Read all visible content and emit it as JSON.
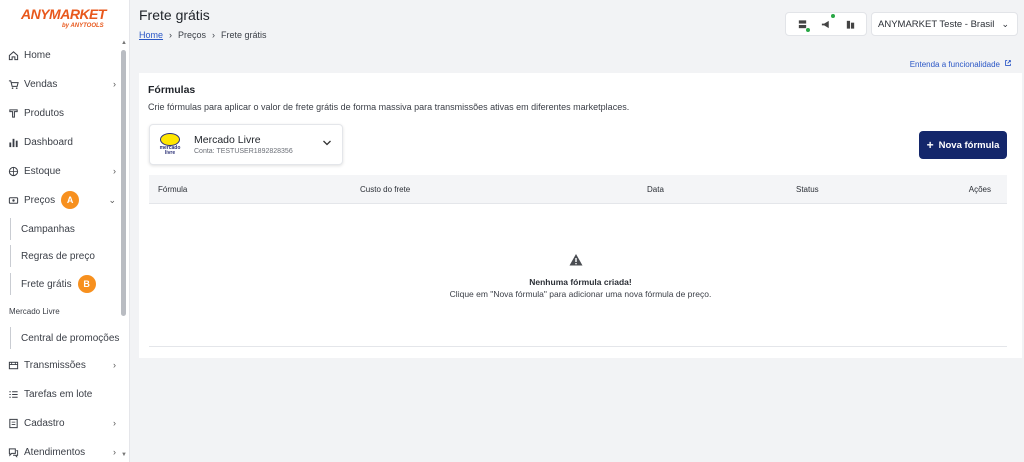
{
  "brand": {
    "name": "ANYMARKET",
    "sub": "by ANYTOOLS"
  },
  "sidebar": {
    "items": [
      {
        "label": "Home",
        "icon": "home-icon",
        "chevron": false
      },
      {
        "label": "Vendas",
        "icon": "cart-icon",
        "chevron": true
      },
      {
        "label": "Produtos",
        "icon": "tag-icon",
        "chevron": false
      },
      {
        "label": "Dashboard",
        "icon": "bar-chart-icon",
        "chevron": false
      },
      {
        "label": "Estoque",
        "icon": "box-icon",
        "chevron": true
      },
      {
        "label": "Preços",
        "icon": "price-icon",
        "chevron": true,
        "expanded": true,
        "badge": "A"
      },
      {
        "label": "Transmissões",
        "icon": "transmission-icon",
        "chevron": true
      },
      {
        "label": "Tarefas em lote",
        "icon": "list-icon",
        "chevron": false
      },
      {
        "label": "Cadastro",
        "icon": "register-icon",
        "chevron": true
      },
      {
        "label": "Atendimentos",
        "icon": "chat-icon",
        "chevron": true
      }
    ],
    "sub_items": [
      {
        "label": "Campanhas"
      },
      {
        "label": "Regras de preço"
      },
      {
        "label": "Frete grátis",
        "badge": "B",
        "active": true
      }
    ],
    "group_label": "Mercado Livre",
    "group_items": [
      {
        "label": "Central de promoções"
      }
    ]
  },
  "header": {
    "title": "Frete grátis",
    "breadcrumb": [
      "Home",
      "Preços",
      "Frete grátis"
    ],
    "account": "ANYMARKET Teste - Brasil"
  },
  "card": {
    "learn_link": "Entenda a funcionalidade",
    "title": "Fórmulas",
    "description": "Crie fórmulas para aplicar o valor de frete grátis de forma massiva para transmissões ativas em diferentes marketplaces.",
    "marketplace": {
      "name": "Mercado Livre",
      "account": "Conta: TESTUSER1892828356",
      "logo_text_1": "mercado",
      "logo_text_2": "livre"
    },
    "new_button": "Nova fórmula",
    "columns": [
      "Fórmula",
      "Custo do frete",
      "Data",
      "Status",
      "Ações"
    ],
    "empty_title": "Nenhuma fórmula criada!",
    "empty_desc": "Clique em \"Nova fórmula\" para adicionar uma nova fórmula de preço."
  },
  "colors": {
    "brand": "#e8581c",
    "badge": "#f7901e",
    "primary_button": "#14276b",
    "link": "#2b57c6"
  }
}
